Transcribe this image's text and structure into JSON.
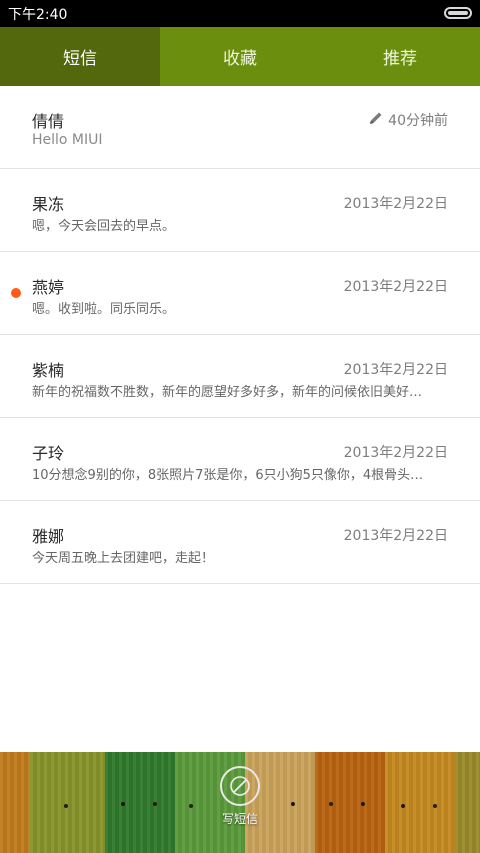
{
  "status_bar": {
    "time": "下午2:40"
  },
  "tabs": [
    {
      "label": "短信",
      "active": true
    },
    {
      "label": "收藏",
      "active": false
    },
    {
      "label": "推荐",
      "active": false
    }
  ],
  "messages": [
    {
      "name": "倩倩",
      "time": "40分钟前",
      "preview": "Hello MIUI",
      "draft": true,
      "unread": false
    },
    {
      "name": "果冻",
      "time": "2013年2月22日",
      "preview": "嗯，今天会回去的早点。",
      "draft": false,
      "unread": false
    },
    {
      "name": "燕婷",
      "time": "2013年2月22日",
      "preview": "嗯。收到啦。同乐同乐。",
      "draft": false,
      "unread": true
    },
    {
      "name": "紫楠",
      "time": "2013年2月22日",
      "preview": "新年的祝福数不胜数，新年的愿望好多好多，新年的问候依旧美好…",
      "draft": false,
      "unread": false
    },
    {
      "name": "子玲",
      "time": "2013年2月22日",
      "preview": "10分想念9别的你，8张照片7张是你，6只小狗5只像你，4根骨头…",
      "draft": false,
      "unread": false
    },
    {
      "name": "雅娜",
      "time": "2013年2月22日",
      "preview": "今天周五晚上去团建吧，走起！",
      "draft": false,
      "unread": false
    }
  ],
  "compose": {
    "label": "写短信",
    "icon": "compose-icon"
  },
  "colors": {
    "tab_bar": "#6b8e0f",
    "tab_active": "#53680d",
    "unread_dot": "#ff5a16"
  }
}
